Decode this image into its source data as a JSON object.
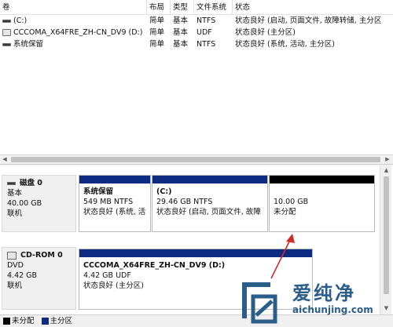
{
  "volume_list": {
    "columns": [
      "卷",
      "布局",
      "类型",
      "文件系统",
      "状态"
    ],
    "rows": [
      {
        "icon": "bar",
        "volume": "(C:)",
        "layout": "简单",
        "type": "基本",
        "fs": "NTFS",
        "status": "状态良好 (启动, 页面文件, 故障转储, 主分区"
      },
      {
        "icon": "cd",
        "volume": "CCCOMA_X64FRE_ZH-CN_DV9 (D:)",
        "layout": "简单",
        "type": "基本",
        "fs": "UDF",
        "status": "状态良好 (主分区)"
      },
      {
        "icon": "bar",
        "volume": "系统保留",
        "layout": "简单",
        "type": "基本",
        "fs": "NTFS",
        "status": "状态良好 (系统, 活动, 主分区)"
      }
    ]
  },
  "disks": [
    {
      "name": "磁盘 0",
      "type": "基本",
      "size": "40.00 GB",
      "status": "联机",
      "partitions": [
        {
          "title": "系统保留",
          "size_fs": "549 MB NTFS",
          "status": "状态良好 (系统, 活",
          "color": "#0d2b80"
        },
        {
          "title": "(C:)",
          "size_fs": "29.46 GB NTFS",
          "status": "状态良好 (启动, 页面文件, 故障",
          "color": "#0d2b80"
        },
        {
          "title": "",
          "size_fs": "10.00 GB",
          "status": "未分配",
          "color": "#000000"
        }
      ]
    },
    {
      "name": "CD-ROM 0",
      "type": "DVD",
      "size": "4.42 GB",
      "status": "联机",
      "partitions": [
        {
          "title": "CCCOMA_X64FRE_ZH-CN_DV9  (D:)",
          "size_fs": "4.42 GB UDF",
          "status": "状态良好 (主分区)",
          "color": "#0d2b80"
        }
      ]
    }
  ],
  "legend": [
    {
      "label": "未分配",
      "color": "#000000"
    },
    {
      "label": "主分区",
      "color": "#0d2b80"
    }
  ],
  "watermark": {
    "brand": "爱纯净",
    "url": "aichunjing.com",
    "color": "#2a5d8a"
  },
  "annotation_color": "#d42a2a"
}
